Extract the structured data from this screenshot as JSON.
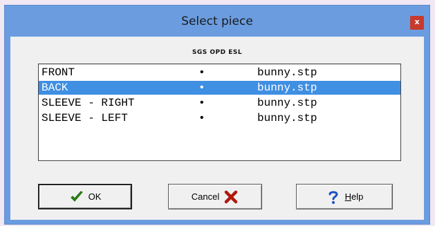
{
  "window": {
    "title": "Select piece",
    "close_label": "x"
  },
  "header": {
    "codes": "SGS OPD ESL"
  },
  "list": {
    "items": [
      {
        "name": "FRONT",
        "marker": "•",
        "file": "bunny.stp",
        "selected": false
      },
      {
        "name": "BACK",
        "marker": "•",
        "file": "bunny.stp",
        "selected": true
      },
      {
        "name": "SLEEVE - RIGHT",
        "marker": "•",
        "file": "bunny.stp",
        "selected": false
      },
      {
        "name": "SLEEVE - LEFT",
        "marker": "•",
        "file": "bunny.stp",
        "selected": false
      }
    ]
  },
  "buttons": {
    "ok_label": "OK",
    "cancel_label": "Cancel",
    "help_label": "Help",
    "ok_icon": "checkmark-icon",
    "cancel_icon": "red-x-icon",
    "help_icon": "question-mark-icon"
  },
  "colors": {
    "titlebar": "#6b9ce0",
    "selection": "#3f8fe3",
    "close_button": "#c83a2c",
    "ok_check": "#2e8b16",
    "cancel_x": "#b0180e",
    "help_q": "#1b4fc4"
  }
}
